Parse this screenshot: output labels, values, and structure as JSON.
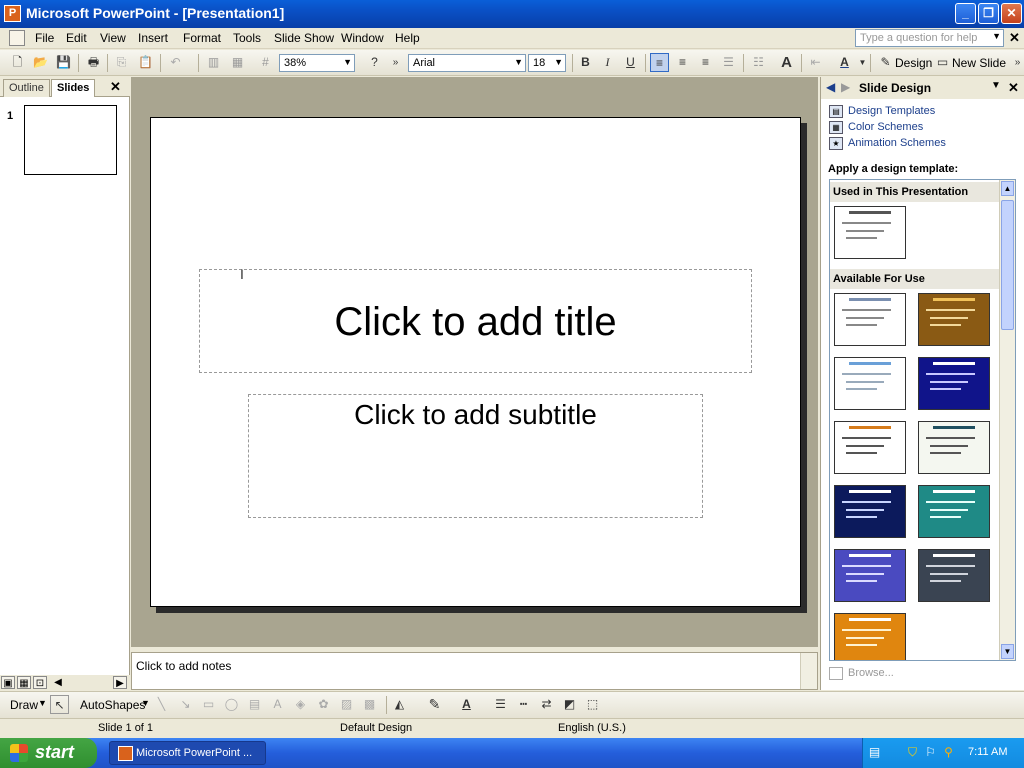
{
  "window": {
    "title": "Microsoft PowerPoint - [Presentation1]"
  },
  "menu": {
    "items": [
      "File",
      "Edit",
      "View",
      "Insert",
      "Format",
      "Tools",
      "Slide Show",
      "Window",
      "Help"
    ],
    "help_placeholder": "Type a question for help"
  },
  "toolbar": {
    "zoom": "38%",
    "font": "Arial",
    "font_size": "18",
    "bold": "B",
    "italic": "I",
    "underline": "U",
    "design_label": "Design",
    "new_slide_label": "New Slide"
  },
  "left_pane": {
    "tab_outline": "Outline",
    "tab_slides": "Slides",
    "slide_number": "1"
  },
  "slide": {
    "title_placeholder": "Click to add title",
    "subtitle_placeholder": "Click to add subtitle"
  },
  "notes": {
    "placeholder": "Click to add notes"
  },
  "task_pane": {
    "title": "Slide Design",
    "links": [
      "Design Templates",
      "Color Schemes",
      "Animation Schemes"
    ],
    "apply_label": "Apply a design template:",
    "section_used": "Used in This Presentation",
    "section_available": "Available For Use",
    "browse_label": "Browse...",
    "templates": [
      {
        "bg": "#ffffff",
        "title": "#555555",
        "text": "#888888"
      },
      {
        "bg": "#ffffff",
        "title": "#7a8fb0",
        "text": "#888888"
      },
      {
        "bg": "#8a5a14",
        "title": "#f1c25a",
        "text": "#f3d99a"
      },
      {
        "bg": "#ffffff",
        "title": "#6aa0d8",
        "text": "#9ab"
      },
      {
        "bg": "#10148a",
        "title": "#ffffff",
        "text": "#c8c8ff"
      },
      {
        "bg": "#ffffff",
        "title": "#d67b1b",
        "text": "#555555"
      },
      {
        "bg": "#f4f7f0",
        "title": "#1f4f5f",
        "text": "#555555"
      },
      {
        "bg": "#0c1a5c",
        "title": "#ffffff",
        "text": "#c8d4ff"
      },
      {
        "bg": "#1f8a86",
        "title": "#ffffff",
        "text": "#e6fffa"
      },
      {
        "bg": "#4a4ac0",
        "title": "#ffffff",
        "text": "#dadaff"
      },
      {
        "bg": "#3a4452",
        "title": "#ffffff",
        "text": "#d0d4dc"
      },
      {
        "bg": "#e0860f",
        "title": "#ffffff",
        "text": "#fff2d0"
      }
    ]
  },
  "drawing": {
    "draw_label": "Draw",
    "autoshapes_label": "AutoShapes"
  },
  "status": {
    "slide": "Slide 1 of 1",
    "design": "Default Design",
    "language": "English (U.S.)"
  },
  "taskbar": {
    "start_label": "start",
    "item_label": "Microsoft PowerPoint ...",
    "clock": "7:11 AM"
  },
  "colors": {
    "titlebar": "#0a4fc4",
    "link": "#1c3f8c",
    "slide_area": "#a9a590"
  }
}
